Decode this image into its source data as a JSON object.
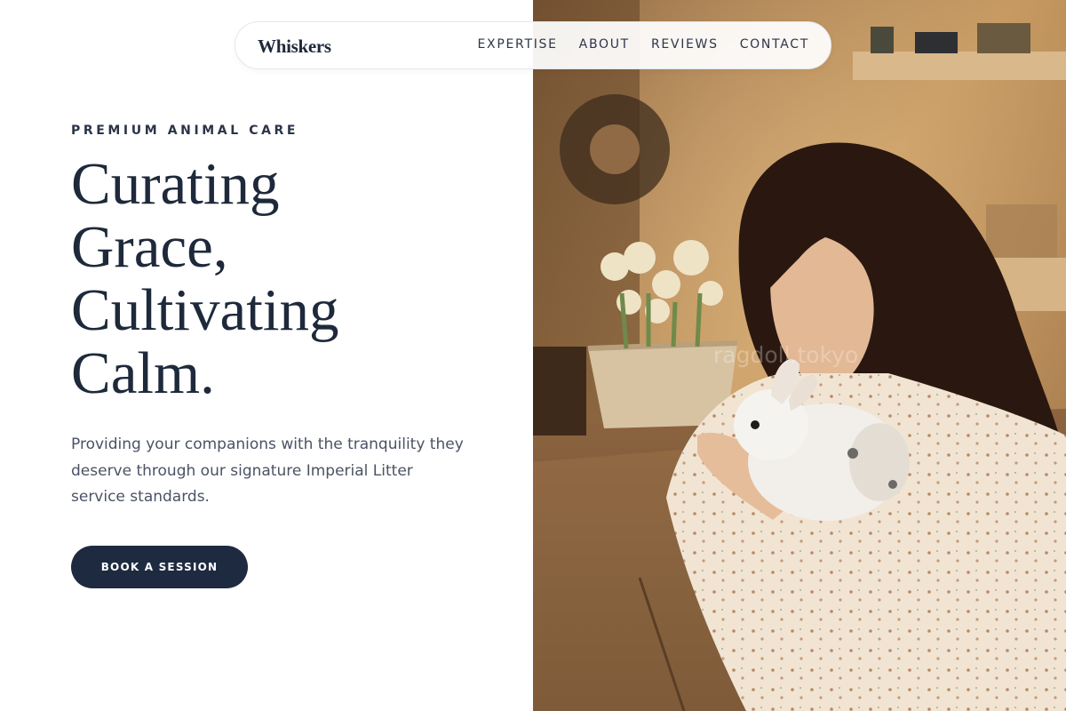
{
  "nav": {
    "brand": "Whiskers",
    "links": [
      "EXPERTISE",
      "ABOUT",
      "REVIEWS",
      "CONTACT"
    ]
  },
  "hero": {
    "eyebrow": "PREMIUM ANIMAL CARE",
    "headline_lines": [
      "Curating",
      "Grace,",
      "Cultivating",
      "Calm."
    ],
    "description": "Providing your companions with the tranquility they deserve through our signature Imperial Litter service standards.",
    "cta_label": "BOOK A SESSION"
  },
  "photo": {
    "watermark": "ragdoll.tokyo"
  },
  "colors": {
    "navy": "#1e293b",
    "button": "#1e2a40",
    "body_text": "#4a5365",
    "photo_warm": "#b78a5a"
  }
}
